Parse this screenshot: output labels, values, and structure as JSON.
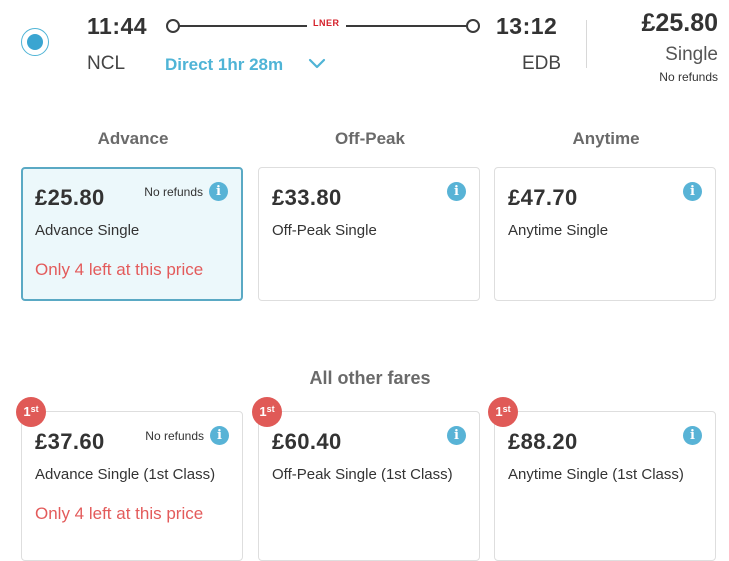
{
  "journey": {
    "depart_time": "11:44",
    "arrive_time": "13:12",
    "from": "NCL",
    "to": "EDB",
    "operator": "LNER",
    "direct_label": "Direct 1hr 28m",
    "selected_price": "£25.80",
    "selected_type": "Single",
    "selected_refund": "No refunds"
  },
  "fare_columns": [
    "Advance",
    "Off-Peak",
    "Anytime"
  ],
  "standard_fares": [
    {
      "price": "£25.80",
      "name": "Advance Single",
      "refund": "No refunds",
      "warning": "Only 4 left at this price",
      "selected": true
    },
    {
      "price": "£33.80",
      "name": "Off-Peak Single",
      "refund": "",
      "warning": "",
      "selected": false
    },
    {
      "price": "£47.70",
      "name": "Anytime Single",
      "refund": "",
      "warning": "",
      "selected": false
    }
  ],
  "other_fares_title": "All other fares",
  "first_class_badge": {
    "main": "1",
    "sup": "st"
  },
  "first_class_fares": [
    {
      "price": "£37.60",
      "name": "Advance Single (1st Class)",
      "refund": "No refunds",
      "warning": "Only 4 left at this price"
    },
    {
      "price": "£60.40",
      "name": "Off-Peak Single (1st Class)",
      "refund": "",
      "warning": ""
    },
    {
      "price": "£88.20",
      "name": "Anytime Single (1st Class)",
      "refund": "",
      "warning": ""
    }
  ],
  "icons": {
    "info": "info-icon",
    "chevron": "chevron-down-icon",
    "radio": "radio-selected-icon"
  },
  "colors": {
    "accent": "#4fb4d6",
    "warning": "#e35b5b",
    "badge": "#e05a57",
    "selected_bg": "#ecf8fb"
  }
}
